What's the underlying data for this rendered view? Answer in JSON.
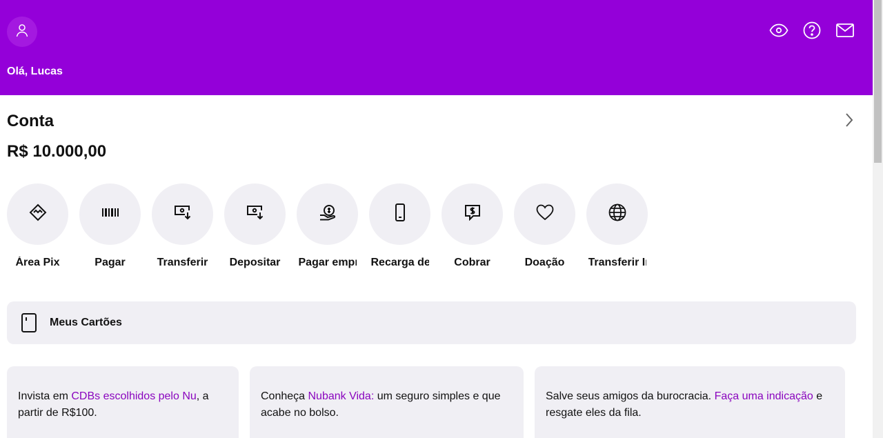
{
  "header": {
    "greeting": "Olá, Lucas",
    "avatar_icon": "user-icon",
    "icons": [
      "eye-icon",
      "help-icon",
      "mail-icon"
    ],
    "color": "#9400d9"
  },
  "account": {
    "title": "Conta",
    "balance": "R$ 10.000,00"
  },
  "actions": [
    {
      "label": "Área Pix",
      "icon": "pix-icon"
    },
    {
      "label": "Pagar",
      "icon": "barcode-icon"
    },
    {
      "label": "Transferir",
      "icon": "transfer-icon"
    },
    {
      "label": "Depositar",
      "icon": "deposit-icon"
    },
    {
      "label": "Pagar empréstimo",
      "icon": "loan-icon"
    },
    {
      "label": "Recarga de celular",
      "icon": "phone-icon"
    },
    {
      "label": "Cobrar",
      "icon": "charge-icon"
    },
    {
      "label": "Doação",
      "icon": "heart-icon"
    },
    {
      "label": "Transferir Internac.",
      "icon": "globe-icon"
    }
  ],
  "cards": {
    "label": "Meus Cartões",
    "icon": "card-icon"
  },
  "promos": [
    {
      "before": "Invista em ",
      "link": "CDBs escolhidos pelo Nu",
      "after": ", a partir de R$100."
    },
    {
      "before": "Conheça ",
      "link": "Nubank Vida:",
      "after": " um seguro simples e que acabe no bolso."
    },
    {
      "before": "Salve seus amigos da burocracia. ",
      "link": "Faça uma indicação",
      "after": " e resgate eles da fila."
    }
  ],
  "colors": {
    "accent": "#8a05be",
    "surface": "#f0eff4"
  }
}
